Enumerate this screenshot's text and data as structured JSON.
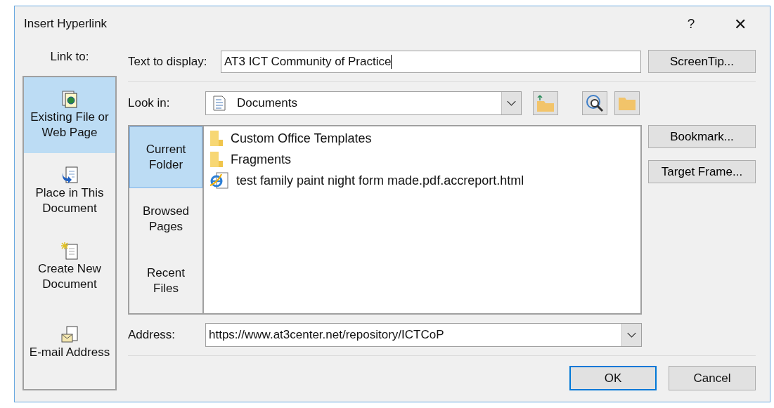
{
  "window": {
    "title": "Insert Hyperlink",
    "help": "?",
    "close": "✕"
  },
  "link_to": {
    "label": "Link to:",
    "items": [
      {
        "label": "Existing File or Web Page",
        "kind": "file",
        "selected": true
      },
      {
        "label": "Place in This Document",
        "kind": "place",
        "selected": false
      },
      {
        "label": "Create New Document",
        "kind": "new",
        "selected": false
      },
      {
        "label": "E-mail Address",
        "kind": "email",
        "selected": false
      }
    ]
  },
  "text_to_display": {
    "label": "Text to display:",
    "value": "AT3 ICT Community of Practice"
  },
  "look_in": {
    "label": "Look in:",
    "value": "Documents"
  },
  "nav": [
    {
      "label": "Current Folder",
      "selected": true
    },
    {
      "label": "Browsed Pages",
      "selected": false
    },
    {
      "label": "Recent Files",
      "selected": false
    }
  ],
  "files": [
    {
      "name": "Custom Office Templates",
      "kind": "folder"
    },
    {
      "name": "Fragments",
      "kind": "folder"
    },
    {
      "name": "test family paint night form made.pdf.accreport.html",
      "kind": "web"
    }
  ],
  "side_buttons": [
    "ScreenTip...",
    "Bookmark...",
    "Target Frame..."
  ],
  "address": {
    "label": "Address:",
    "value": "https://www.at3center.net/repository/ICTCoP"
  },
  "buttons": [
    {
      "label": "OK",
      "default": true
    },
    {
      "label": "Cancel",
      "default": false
    }
  ]
}
